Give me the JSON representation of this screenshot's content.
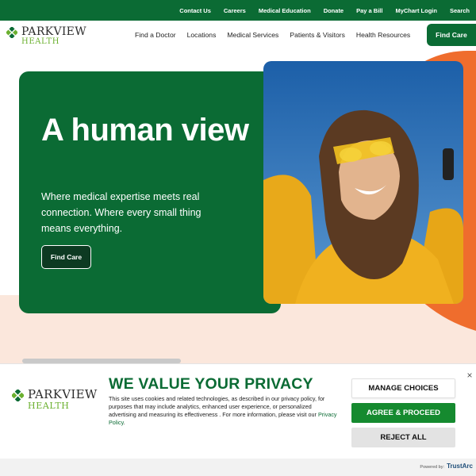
{
  "utility_nav": [
    "Contact Us",
    "Careers",
    "Medical Education",
    "Donate",
    "Pay a Bill",
    "MyChart Login",
    "Search"
  ],
  "logo": {
    "line1": "PARKVIEW",
    "line2": "HEALTH"
  },
  "main_nav": [
    "Find a Doctor",
    "Locations",
    "Medical Services",
    "Patients & Visitors",
    "Health Resources"
  ],
  "find_care_button": "Find Care",
  "hero": {
    "title": "A human view",
    "subtitle": "Where medical expertise meets real connection. Where every small thing means everything.",
    "cta_label": "Find Care"
  },
  "consent": {
    "title": "WE VALUE YOUR PRIVACY",
    "body": "This site uses cookies and related technologies, as described in our privacy policy, for purposes that may include analytics, enhanced user experience, or personalized advertising and measuring its effectiveness . For more information, please visit our",
    "link_label": "Privacy Policy",
    "link_suffix": ".",
    "close_icon": "×",
    "manage_label": "MANAGE CHOICES",
    "agree_label": "AGREE & PROCEED",
    "reject_label": "REJECT ALL"
  },
  "footer": {
    "powered_by": "Powered by:",
    "vendor": "TrustArc"
  },
  "colors": {
    "brand_green": "#0b6b34",
    "accent_orange": "#ef6d2d",
    "logo_green": "#6bb02f",
    "agree_green": "#158a2f"
  }
}
